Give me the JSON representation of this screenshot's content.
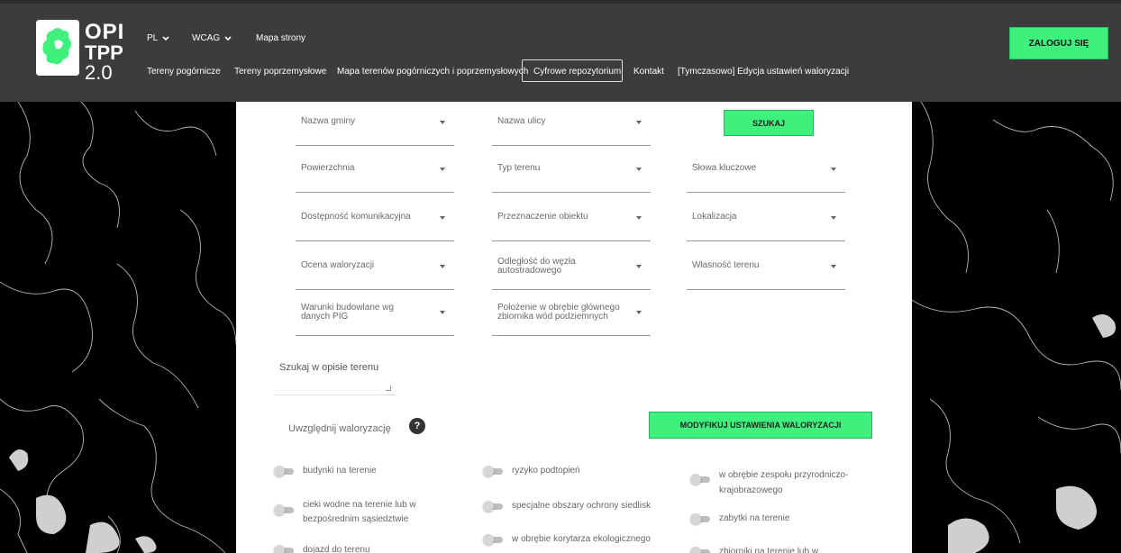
{
  "header": {
    "logo": {
      "line1": "OPI",
      "line2": "TPP",
      "line3": "2.0"
    },
    "top_links": [
      {
        "label": "PL"
      },
      {
        "label": "WCAG"
      },
      {
        "label": "Mapa strony"
      }
    ],
    "nav": [
      {
        "label": "Tereny pogórnicze"
      },
      {
        "label": "Tereny poprzemysłowe"
      },
      {
        "label": "Mapa terenów pogórniczych i poprzemysłowych"
      },
      {
        "label": "Cyfrowe repozytorium"
      },
      {
        "label": "Kontakt"
      },
      {
        "label": "[Tymczasowo] Edycja ustawień waloryzacji"
      }
    ],
    "login_label": "ZALOGUJ SIĘ"
  },
  "filters": {
    "search_label": "SZUKAJ",
    "dropdowns": [
      {
        "label": "Nazwa gminy"
      },
      {
        "label": "Nazwa ulicy"
      },
      {
        "label": "Powierzchnia"
      },
      {
        "label": "Typ terenu"
      },
      {
        "label": "Słowa kluczowe"
      },
      {
        "label": "Dostępność komunikacyjna"
      },
      {
        "label": "Przeznaczenie obiektu"
      },
      {
        "label": "Lokalizacja"
      },
      {
        "label": "Ocena waloryzacji"
      },
      {
        "label": "Odległość do węzła autostradowego"
      },
      {
        "label": "Własność terenu"
      },
      {
        "label": "Warunki budowlane wg danych PIG"
      },
      {
        "label": "Położenie w obrębie głównego zbiornika wód podziemnych"
      }
    ],
    "description_label": "Szukaj w opisie terenu",
    "valorization_label": "Uwzględnij waloryzację",
    "help_label": "?",
    "modify_label": "MODYFIKUJ USTAWIENIA WALORYZACJI"
  },
  "options": [
    {
      "label": "budynki na terenie"
    },
    {
      "label": "ryzyko podtopień"
    },
    {
      "label": "w obrębie zespołu przyrodniczo-krajobrazowego"
    },
    {
      "label": "cieki wodne na terenie lub w bezpośrednim sąsiedztwie"
    },
    {
      "label": "specjalne obszary ochrony siedlisk"
    },
    {
      "label": "zabytki na terenie"
    },
    {
      "label": "w obrębie korytarza ekologicznego"
    },
    {
      "label": "dojazd do terenu"
    },
    {
      "label": "zbiorniki na terenie lub w"
    }
  ],
  "colors": {
    "header_bg": "#3c3c3c",
    "accent_green": "#3ff07c",
    "map_bg": "#000000",
    "map_lines": "#bbbbbb"
  }
}
